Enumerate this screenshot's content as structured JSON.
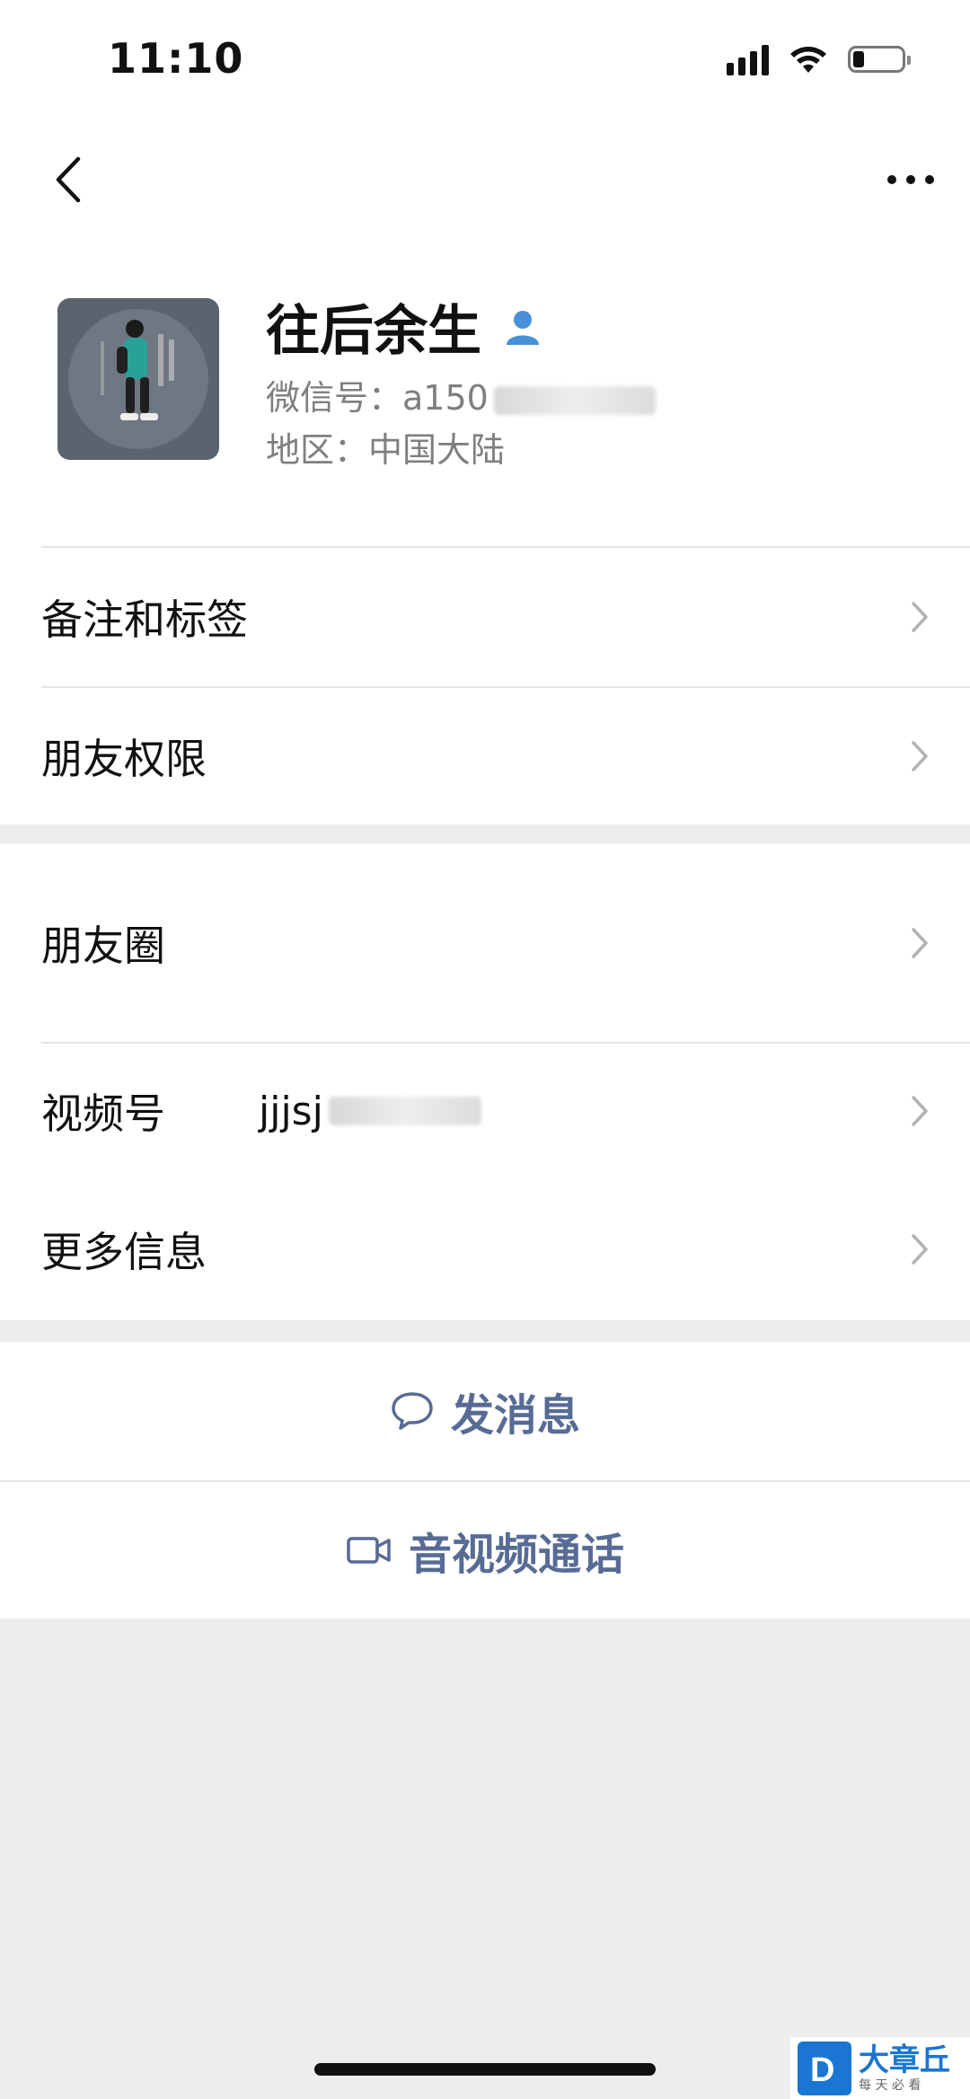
{
  "status_bar": {
    "time": "11:10"
  },
  "nav": {
    "back_icon": "chevron-left-icon",
    "more_icon": "more-dots-icon"
  },
  "profile": {
    "name": "往后余生",
    "wechat_id_label": "微信号：",
    "wechat_id_value": "a150",
    "region_label": "地区：",
    "region_value": "中国大陆"
  },
  "cells": {
    "remarks": "备注和标签",
    "friend_permissions": "朋友权限",
    "moments": "朋友圈",
    "channels": "视频号",
    "channels_value": "jjjsj",
    "more_info": "更多信息"
  },
  "actions": {
    "send_message": "发消息",
    "av_call": "音视频通话"
  },
  "colors": {
    "link": "#576b95",
    "background": "#ededed",
    "contact_badge": "#4a90d9"
  },
  "watermark": {
    "text": "大章丘",
    "subtext": "每 天 必 看"
  }
}
